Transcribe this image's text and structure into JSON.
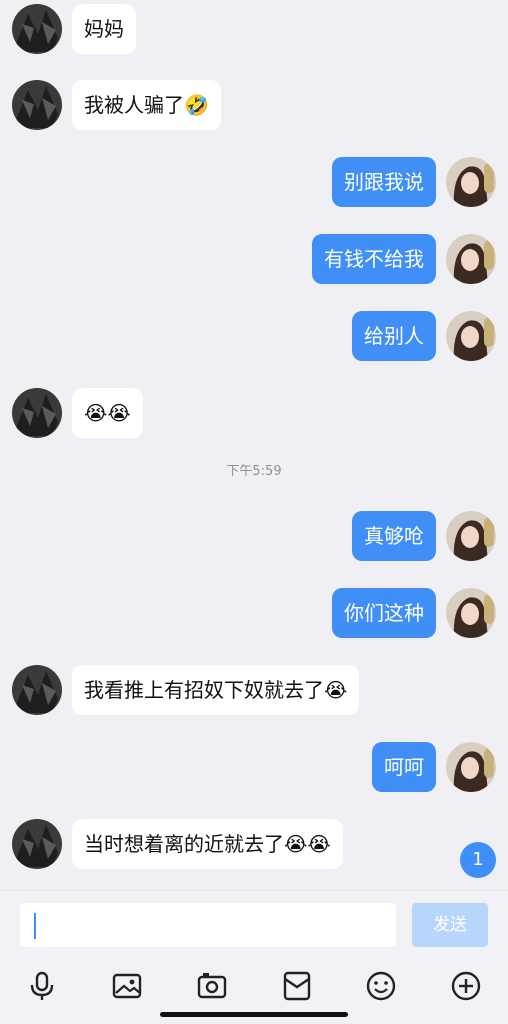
{
  "messages": [
    {
      "side": "in",
      "text": "妈妈"
    },
    {
      "side": "in",
      "text": "我被人骗了🤣"
    },
    {
      "side": "out",
      "text": "别跟我说"
    },
    {
      "side": "out",
      "text": "有钱不给我"
    },
    {
      "side": "out",
      "text": "给别人"
    },
    {
      "side": "in",
      "text": "😭😭"
    },
    {
      "side": "out",
      "text": "真够呛"
    },
    {
      "side": "out",
      "text": "你们这种"
    },
    {
      "side": "in",
      "text": "我看推上有招奴下奴就去了😭"
    },
    {
      "side": "out",
      "text": "呵呵"
    },
    {
      "side": "in",
      "text": "当时想着离的近就去了😭😭"
    }
  ],
  "timestamp": "下午5:59",
  "unread_count": "1",
  "input": {
    "value": "",
    "send_label": "发送"
  },
  "toolbar": [
    "microphone-icon",
    "image-icon",
    "camera-icon",
    "inbox-icon",
    "emoji-icon",
    "plus-icon"
  ],
  "colors": {
    "accent": "#3f8ff6",
    "background": "#efeff4",
    "send_disabled": "#b8d6fb"
  }
}
